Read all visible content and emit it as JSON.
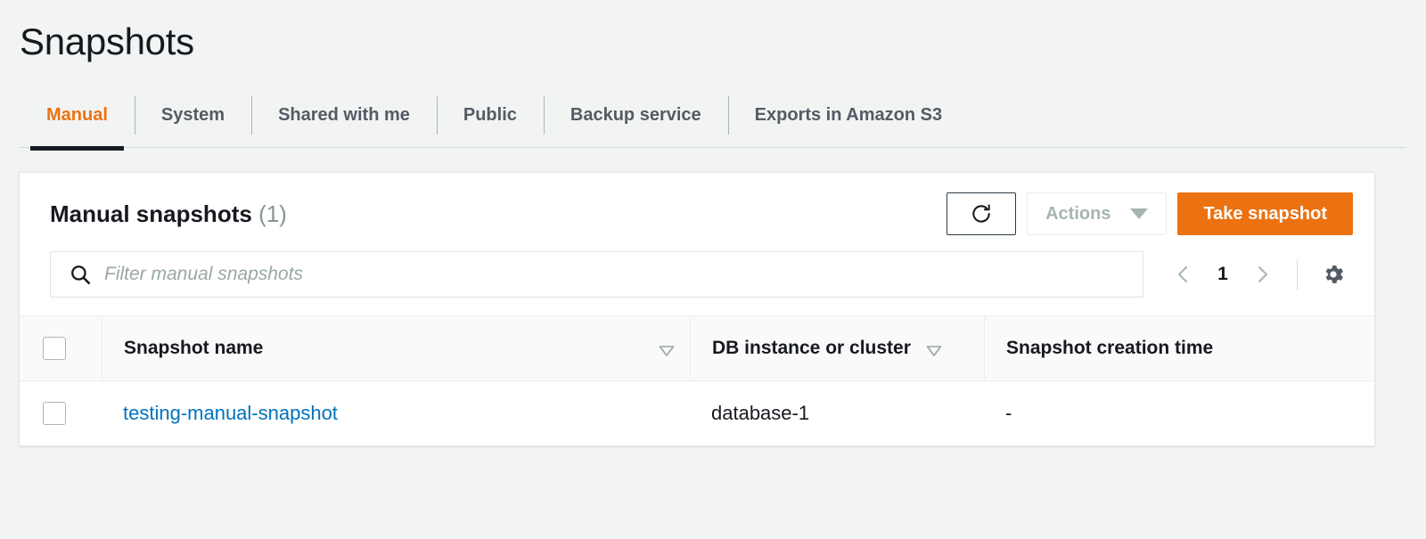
{
  "page": {
    "title": "Snapshots"
  },
  "tabs": [
    {
      "label": "Manual",
      "active": true
    },
    {
      "label": "System",
      "active": false
    },
    {
      "label": "Shared with me",
      "active": false
    },
    {
      "label": "Public",
      "active": false
    },
    {
      "label": "Backup service",
      "active": false
    },
    {
      "label": "Exports in Amazon S3",
      "active": false
    }
  ],
  "panel": {
    "title": "Manual snapshots",
    "count": "(1)",
    "refresh_icon": "refresh-icon",
    "actions_label": "Actions",
    "actions_caret_icon": "chevron-down-icon",
    "primary_label": "Take snapshot"
  },
  "search": {
    "icon": "search-icon",
    "placeholder": "Filter manual snapshots",
    "value": ""
  },
  "pagination": {
    "prev_icon": "chevron-left-icon",
    "page": "1",
    "next_icon": "chevron-right-icon",
    "settings_icon": "gear-icon"
  },
  "table": {
    "columns": [
      {
        "label": "Snapshot name",
        "sortable": true
      },
      {
        "label": "DB instance or cluster",
        "sortable": true
      },
      {
        "label": "Snapshot creation time",
        "sortable": false
      }
    ],
    "rows": [
      {
        "name": "testing-manual-snapshot",
        "db": "database-1",
        "created": "-"
      }
    ]
  },
  "colors": {
    "accent_orange": "#ec7211",
    "link_blue": "#0073bb",
    "page_bg": "#f2f3f3",
    "muted": "#879596"
  }
}
